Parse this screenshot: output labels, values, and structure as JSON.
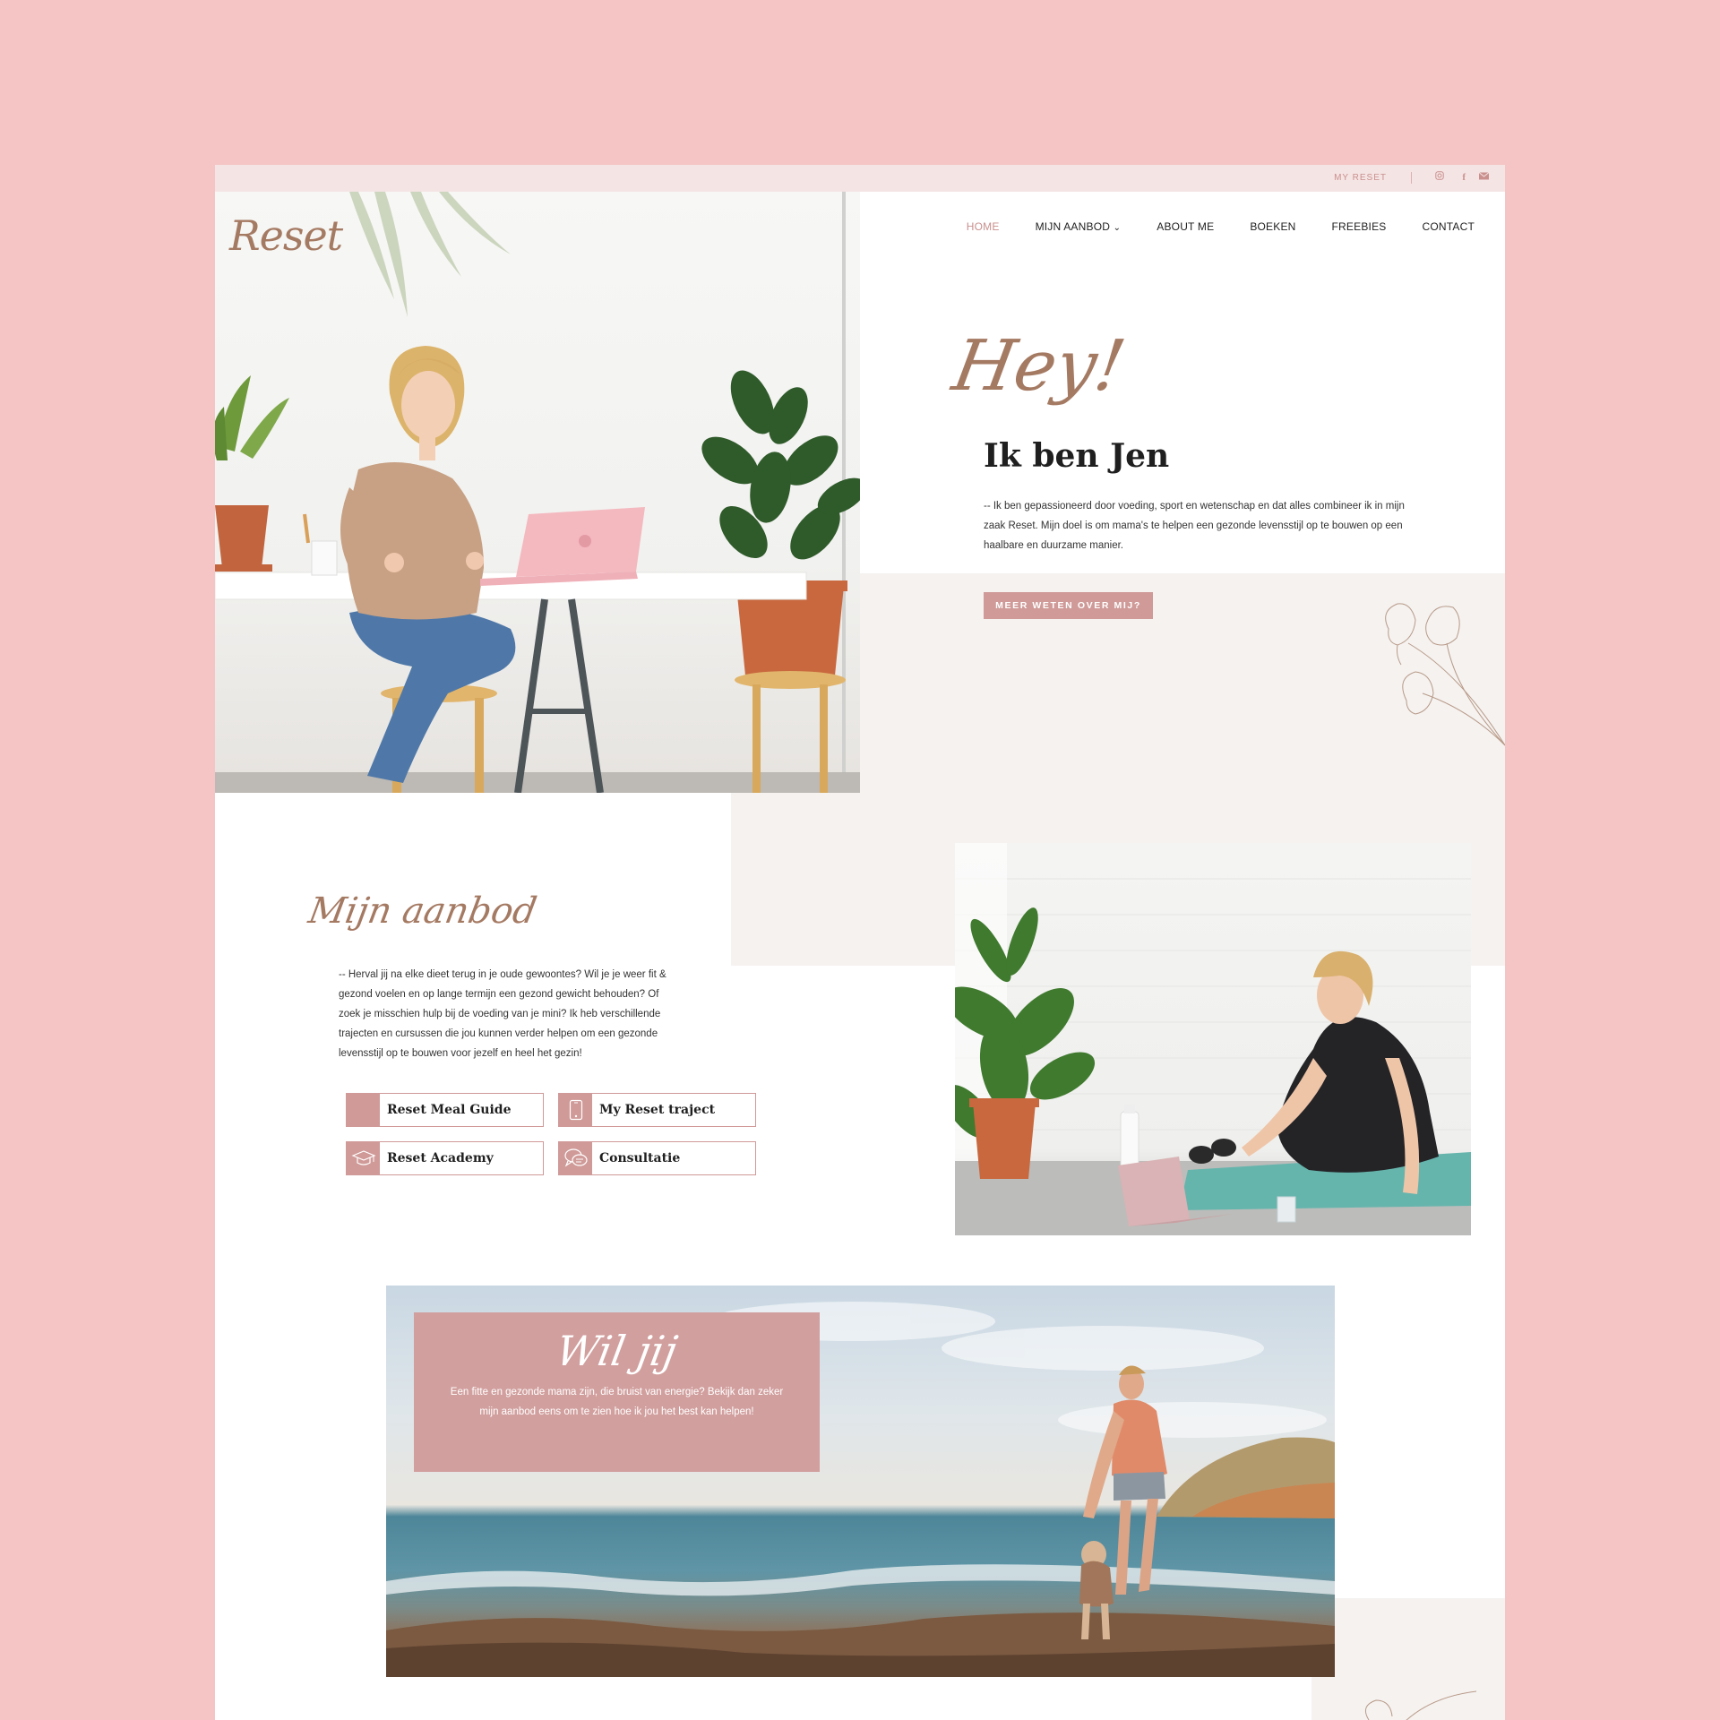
{
  "topbar": {
    "my_reset": "MY RESET"
  },
  "logo": "Reset",
  "nav": [
    {
      "label": "HOME",
      "active": true
    },
    {
      "label": "MIJN AANBOD",
      "dropdown": true
    },
    {
      "label": "ABOUT ME"
    },
    {
      "label": "BOEKEN"
    },
    {
      "label": "FREEBIES"
    },
    {
      "label": "CONTACT"
    }
  ],
  "hero": {
    "greeting": "Hey!",
    "title": "Ik ben Jen",
    "text": "--   Ik ben gepassioneerd door voeding, sport en wetenschap en dat alles combineer ik in mijn zaak Reset. Mijn doel is om mama's te helpen een gezonde levensstijl op te bouwen op een haalbare en duurzame manier.",
    "button": "MEER WETEN OVER MIJ?"
  },
  "aanbod": {
    "title": "Mijn aanbod",
    "text": "--   Herval jij na elke dieet terug in je oude gewoontes? Wil je je weer fit & gezond voelen en op lange termijn een gezond gewicht behouden? Of zoek je misschien hulp bij de voeding van je mini? Ik heb verschillende trajecten en cursussen die jou kunnen verder helpen om een gezonde levensstijl op te bouwen voor jezelf en heel het gezin!",
    "offers": [
      {
        "label": "Reset Meal Guide",
        "icon": "blank-icon"
      },
      {
        "label": "My Reset traject",
        "icon": "phone-icon"
      },
      {
        "label": "Reset Academy",
        "icon": "graduation-cap-icon"
      },
      {
        "label": "Consultatie",
        "icon": "chat-bubbles-icon"
      }
    ]
  },
  "wiljij": {
    "title": "Wil jij",
    "text": "Een fitte en gezonde mama zijn, die bruist van energie? Bekijk dan zeker mijn aanbod eens om te zien hoe ik jou het best kan helpen!"
  },
  "colors": {
    "background": "#f5c4c4",
    "accent": "#cf9a98",
    "script": "#a57a63",
    "topbar": "#f5e4e4",
    "section_bg": "#f5f2f0"
  }
}
